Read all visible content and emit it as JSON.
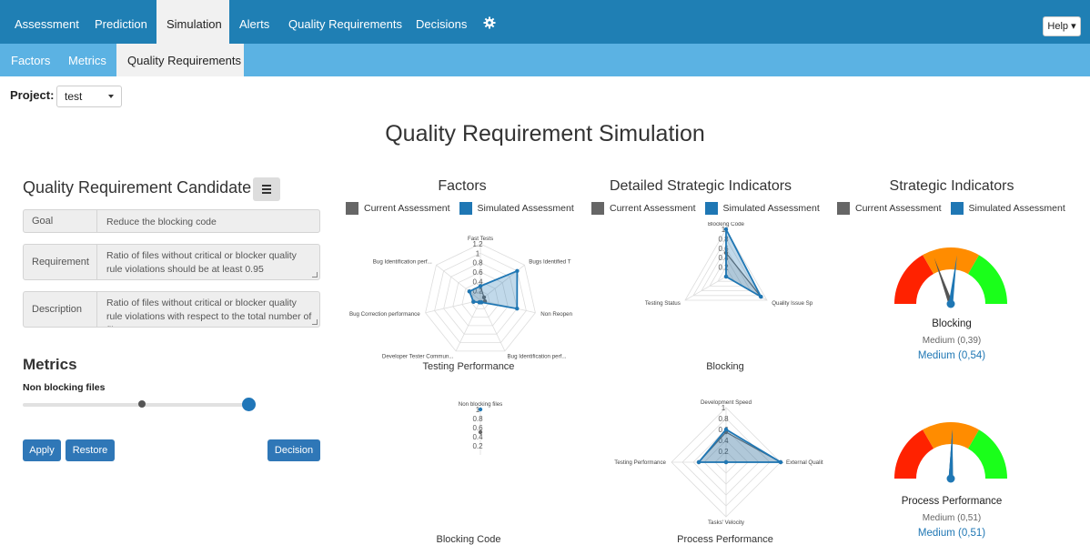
{
  "nav": {
    "tabs": [
      "Assessment",
      "Prediction",
      "Simulation",
      "Alerts",
      "Quality Requirements",
      "Decisions"
    ],
    "active": "Simulation",
    "help": "Help"
  },
  "subnav": {
    "tabs": [
      "Factors",
      "Metrics",
      "Quality Requirements"
    ],
    "active": "Quality Requirements"
  },
  "project": {
    "label": "Project:",
    "value": "test"
  },
  "page_title": "Quality Requirement Simulation",
  "candidate": {
    "title": "Quality Requirement Candidate",
    "rows": [
      {
        "label": "Goal",
        "value": "Reduce the blocking code"
      },
      {
        "label": "Requirement",
        "value": "Ratio of files without critical or blocker quality rule violations should be at least 0.95"
      },
      {
        "label": "Description",
        "value": "Ratio of files without critical or blocker quality rule violations with respect to the total number of files"
      }
    ]
  },
  "metrics": {
    "title": "Metrics",
    "items": [
      {
        "name": "Non blocking files",
        "current": 0.51,
        "simulated": 1.0
      }
    ]
  },
  "buttons": {
    "apply": "Apply",
    "restore": "Restore",
    "decision": "Decision"
  },
  "legend": {
    "current": "Current Assessment",
    "simulated": "Simulated Assessment"
  },
  "colors": {
    "current": "#666666",
    "simulated": "#1f77b4",
    "nav": "#1f7fb4",
    "subnav": "#5bb2e3"
  },
  "columns": {
    "factors": "Factors",
    "detailed": "Detailed Strategic Indicators",
    "strategic": "Strategic Indicators"
  },
  "chart_data": [
    {
      "type": "radar",
      "title": "Testing Performance",
      "axes": [
        "Fast Tests",
        "Bugs Identified T",
        "Non Reopen",
        "Bug Identification perf...",
        "Developer Tester Commun...",
        "Bug Correction performance",
        "Bug Identification perf..."
      ],
      "ticks": [
        "0.2",
        "0.4",
        "0.6",
        "0.8",
        "1",
        "1.2"
      ],
      "max": 1.2,
      "series": [
        {
          "name": "Current Assessment",
          "values": [
            0.3,
            0.1,
            0.1,
            0.05,
            0.05,
            0.15,
            0.3
          ]
        },
        {
          "name": "Simulated Assessment",
          "values": [
            0.3,
            1.0,
            0.8,
            0.05,
            0.05,
            0.15,
            0.3
          ]
        }
      ]
    },
    {
      "type": "radar",
      "title": "Blocking",
      "axes": [
        "Blocking Code",
        "Quality Issue Sp",
        "Testing Status"
      ],
      "ticks": [
        "0.2",
        "0.4",
        "0.6",
        "0.8",
        "1"
      ],
      "max": 1.0,
      "series": [
        {
          "name": "Current Assessment",
          "values": [
            0.5,
            0.85,
            0.0
          ]
        },
        {
          "name": "Simulated Assessment",
          "values": [
            1.0,
            0.85,
            0.0
          ]
        }
      ]
    },
    {
      "type": "radar",
      "title": "Blocking Code",
      "axes": [
        "Non blocking files"
      ],
      "ticks": [
        "0.2",
        "0.4",
        "0.6",
        "0.8",
        "1"
      ],
      "max": 1.0,
      "series": [
        {
          "name": "Current Assessment",
          "values": [
            0.5
          ]
        },
        {
          "name": "Simulated Assessment",
          "values": [
            1.0
          ]
        }
      ]
    },
    {
      "type": "radar",
      "title": "Process Performance",
      "axes": [
        "Development Speed",
        "External Qualit",
        "Tasks' Velocity",
        "Testing Performance"
      ],
      "ticks": [
        "0.2",
        "0.4",
        "0.6",
        "0.8",
        "1"
      ],
      "max": 1.0,
      "series": [
        {
          "name": "Current Assessment",
          "values": [
            0.55,
            1.0,
            0.0,
            0.5
          ]
        },
        {
          "name": "Simulated Assessment",
          "values": [
            0.6,
            1.0,
            0.0,
            0.5
          ]
        }
      ]
    }
  ],
  "strategic_indicators": [
    {
      "name": "Blocking",
      "current": "Medium (0,39)",
      "simulated": "Medium (0,54)",
      "current_value": 0.39,
      "simulated_value": 0.54
    },
    {
      "name": "Process Performance",
      "current": "Medium (0,51)",
      "simulated": "Medium (0,51)",
      "current_value": 0.51,
      "simulated_value": 0.51
    }
  ]
}
